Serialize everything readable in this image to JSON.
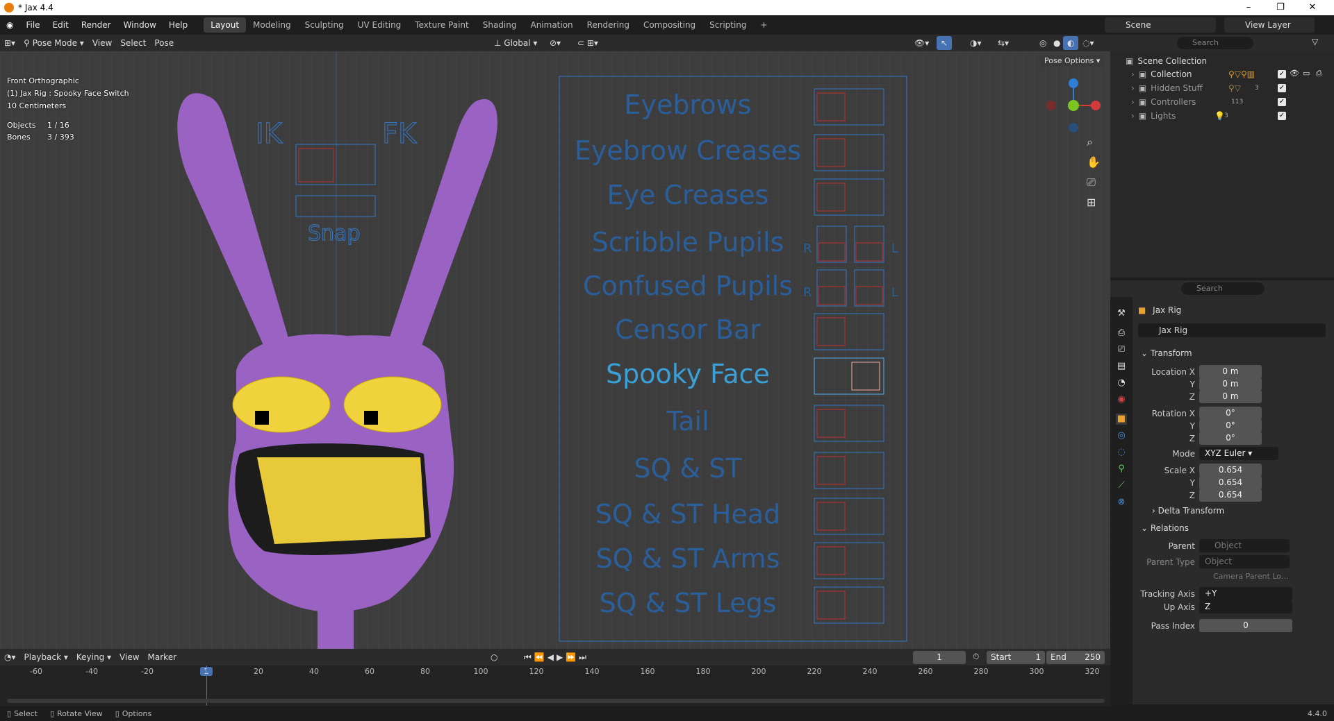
{
  "window": {
    "title": "* Jax 4.4",
    "version": "4.4.0"
  },
  "topbar": {
    "menus": [
      "File",
      "Edit",
      "Render",
      "Window",
      "Help"
    ],
    "workspaces": [
      "Layout",
      "Modeling",
      "Sculpting",
      "UV Editing",
      "Texture Paint",
      "Shading",
      "Animation",
      "Rendering",
      "Compositing",
      "Scripting"
    ],
    "active_workspace": "Layout",
    "scene": "Scene",
    "view_layer": "View Layer"
  },
  "viewport_header": {
    "mode": "Pose Mode",
    "menus": [
      "View",
      "Select",
      "Pose"
    ],
    "orientation": "Global",
    "pose_options": "Pose Options"
  },
  "overlay": {
    "view_name": "Front Orthographic",
    "active": "(1) Jax Rig : Spooky Face Switch",
    "scale": "10 Centimeters",
    "objects_label": "Objects",
    "objects_value": "1 / 16",
    "bones_label": "Bones",
    "bones_value": "3 / 393"
  },
  "rig_ui": {
    "ik": "IK",
    "fk": "FK",
    "snap": "Snap",
    "labels": [
      "Eyebrows",
      "Eyebrow Creases",
      "Eye Creases",
      "Scribble Pupils",
      "Confused Pupils",
      "Censor Bar",
      "Spooky Face",
      "Tail",
      "SQ & ST",
      "SQ & ST Head",
      "SQ & ST Arms",
      "SQ & ST Legs"
    ],
    "r": "R",
    "l": "L"
  },
  "outliner": {
    "search_placeholder": "Search",
    "root": "Scene Collection",
    "items": [
      "Collection",
      "Hidden Stuff",
      "Controllers",
      "Lights"
    ],
    "badge_counts": {
      "hidden": "3",
      "controllers": "113",
      "lights": "3"
    }
  },
  "properties": {
    "search_placeholder": "Search",
    "object_name": "Jax Rig",
    "data_name": "Jax Rig",
    "transform_label": "Transform",
    "location_label": "Location X",
    "location": [
      "0 m",
      "0 m",
      "0 m"
    ],
    "rotation_label": "Rotation X",
    "rotation": [
      "0°",
      "0°",
      "0°"
    ],
    "mode_label": "Mode",
    "mode": "XYZ Euler",
    "scale_label": "Scale X",
    "scale": [
      "0.654",
      "0.654",
      "0.654"
    ],
    "axis_y": "Y",
    "axis_z": "Z",
    "delta_transform": "Delta Transform",
    "relations": "Relations",
    "parent_label": "Parent",
    "parent_placeholder": "Object",
    "parent_type_label": "Parent Type",
    "parent_type": "Object",
    "camera_parent": "Camera Parent Lo...",
    "tracking_axis_label": "Tracking Axis",
    "tracking_axis": "+Y",
    "up_axis_label": "Up Axis",
    "up_axis": "Z",
    "pass_index_label": "Pass Index",
    "pass_index": "0"
  },
  "timeline": {
    "menus": [
      "Playback",
      "Keying",
      "View",
      "Marker"
    ],
    "current_frame": "1",
    "start_label": "Start",
    "start": "1",
    "end_label": "End",
    "end": "250",
    "ticks": [
      "-60",
      "-40",
      "-20",
      "1",
      "20",
      "40",
      "60",
      "80",
      "100",
      "120",
      "140",
      "160",
      "180",
      "200",
      "220",
      "240",
      "260",
      "280",
      "300",
      "320"
    ]
  },
  "statusbar": {
    "select": "Select",
    "rotate": "Rotate View",
    "options": "Options"
  }
}
